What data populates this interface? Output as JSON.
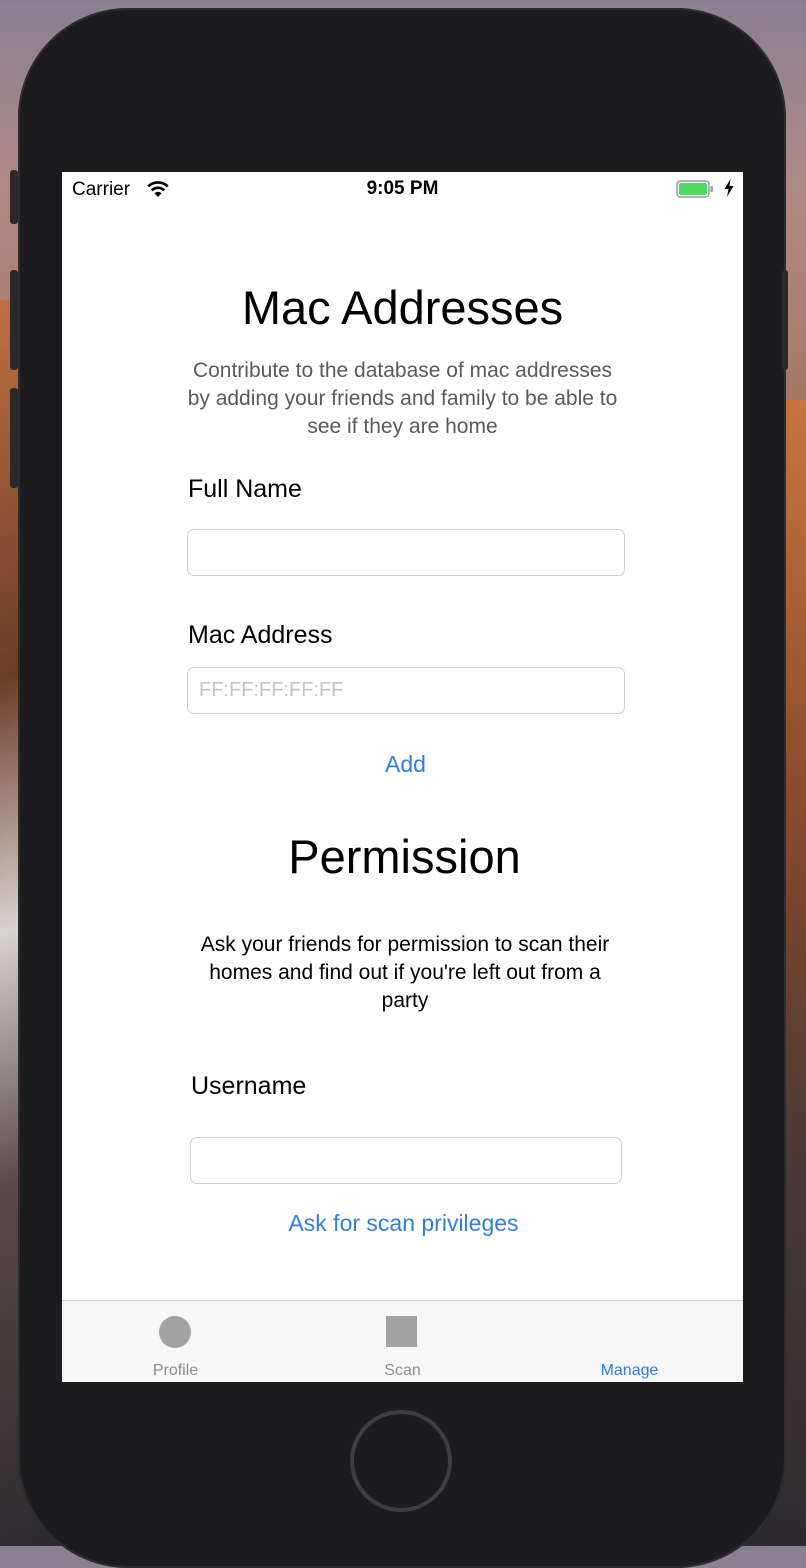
{
  "status_bar": {
    "carrier": "Carrier",
    "time": "9:05 PM"
  },
  "mac_section": {
    "title": "Mac Addresses",
    "description": "Contribute to the database of mac addresses by adding your friends and family to be able to see if they are home",
    "full_name_label": "Full Name",
    "full_name_value": "",
    "mac_label": "Mac Address",
    "mac_placeholder": "FF:FF:FF:FF:FF",
    "add_label": "Add"
  },
  "permission_section": {
    "title": "Permission",
    "description": "Ask your friends for permission to scan their homes and find out if you're left out from a party",
    "username_label": "Username",
    "username_value": "",
    "ask_label": "Ask for scan privileges"
  },
  "tab_bar": {
    "tabs": [
      {
        "label": "Profile",
        "icon": "circle-icon",
        "active": false
      },
      {
        "label": "Scan",
        "icon": "square-icon",
        "active": false
      },
      {
        "label": "Manage",
        "icon": "",
        "active": true
      }
    ]
  },
  "colors": {
    "accent": "#2f7ee6",
    "inactive_tab": "#8e8e93",
    "description_gray": "#5a5a5e",
    "battery_green": "#4cd964"
  }
}
